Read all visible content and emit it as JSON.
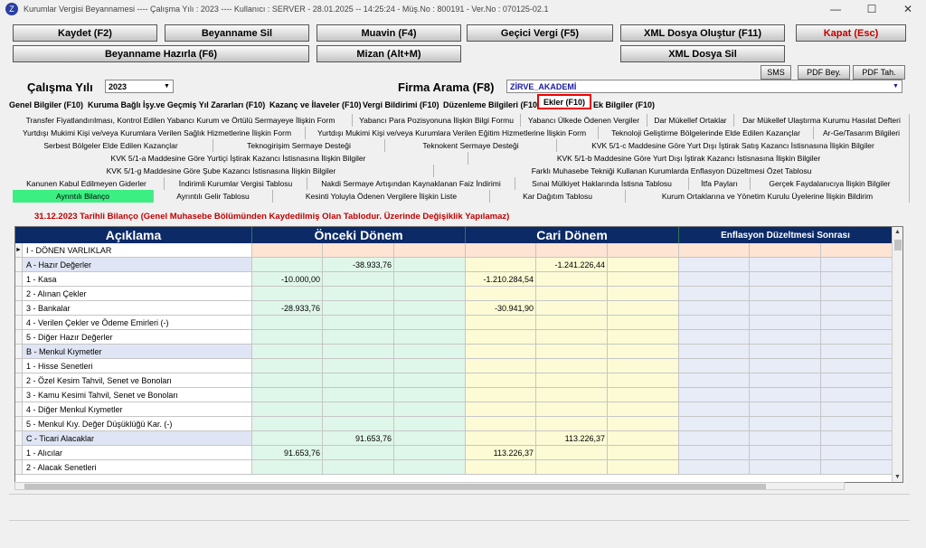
{
  "window": {
    "title": "Kurumlar Vergisi Beyannamesi  ----  Çalışma Yılı : 2023  ----  Kullanıcı : SERVER - 28.01.2025  --  14:25:24  -  Müş.No : 800191  - Ver.No : 070125-02.1",
    "minimize": "—",
    "maximize": "☐",
    "close": "✕"
  },
  "toolbar": {
    "save": "Kaydet (F2)",
    "delete_return": "Beyanname Sil",
    "muavin": "Muavin (F4)",
    "temp_tax": "Geçici Vergi (F5)",
    "xml_create": "XML Dosya Oluştur (F11)",
    "close": "Kapat (Esc)",
    "prepare_return": "Beyanname Hazırla (F6)",
    "mizan": "Mizan (Alt+M)",
    "xml_delete": "XML Dosya Sil",
    "sms": "SMS",
    "pdf_bey": "PDF Bey.",
    "pdf_tah": "PDF Tah."
  },
  "filters": {
    "year_label": "Çalışma Yılı",
    "year_value": "2023",
    "firm_label": "Firma Arama (F8)",
    "firm_value": "ZİRVE_AKADEMİ",
    "dropdown_arrow": "▼"
  },
  "main_tabs": [
    "Genel Bilgiler (F10)",
    "Kuruma Bağlı İşy.ve Geçmiş Yıl Zararları (F10)",
    "Kazanç ve İlaveler (F10)",
    "Vergi Bildirimi (F10)",
    "Düzenleme Bilgileri (F10)",
    "Ekler (F10)",
    "Ek Bilgiler (F10)"
  ],
  "annex_tabs": [
    "Transfer Fiyatlandırılması, Kontrol Edilen Yabancı Kurum ve Örtülü Sermayeye İlişkin Form",
    "Yabancı Para Pozisyonuna İlişkin Bilgi Formu",
    "Yabancı Ülkede Ödenen Vergiler",
    "Dar Mükellef Ortaklar",
    "Dar Mükellef Ulaştırma Kurumu Hasılat Defteri",
    "Yurtdışı Mukimi Kişi ve/veya Kurumlara Verilen Sağlık Hizmetlerine İlişkin Form",
    "Yurtdışı Mukimi Kişi ve/veya Kurumlara Verilen Eğitim Hizmetlerine İlişkin Form",
    "Teknoloji Geliştirme Bölgelerinde Elde Edilen Kazançlar",
    "Ar-Ge/Tasarım Bilgileri",
    "Serbest Bölgeler Elde Edilen Kazançlar",
    "Teknogirişim Sermaye Desteği",
    "Teknokent Sermaye Desteği",
    "KVK 5/1-c Maddesine Göre Yurt Dışı İştirak Satış Kazancı İstisnasına İlişkin Bilgiler",
    "KVK 5/1-a Maddesine Göre Yurtiçi İştirak Kazancı İstisnasına İlişkin Bilgiler",
    "KVK 5/1-b Maddesine Göre Yurt Dışı İştirak Kazancı İstisnasına İlişkin Bilgiler",
    "KVK 5/1-g Maddesine Göre Şube Kazancı İstisnasına İlişkin Bilgiler",
    "Farklı Muhasebe Tekniği Kullanan Kurumlarda Enflasyon Düzeltmesi Özet Tablosu",
    "Kanunen Kabul Edilmeyen Giderler",
    "İndirimli Kurumlar Vergisi Tablosu",
    "Nakdi Sermaye Artışından Kaynaklanan Faiz İndirimi",
    "Sınai Mülkiyet Haklarında İstisna Tablosu",
    "İtfa Payları",
    "Gerçek Faydalanıcıya İlişkin Bilgiler",
    "Ayrıntılı Bilanço",
    "Ayrıntılı Gelir Tablosu",
    "Kesinti Yoluyla Ödenen Vergilere İlişkin Liste",
    "Kar Dağıtım Tablosu",
    "Kurum Ortaklarına ve Yönetim Kurulu Üyelerine İlişkin Bildirim"
  ],
  "balance": {
    "title": "31.12.2023 Tarihli Bilanço (Genel Muhasebe Bölümünden Kaydedilmiş Olan Tablodur. Üzerinde Değişiklik Yapılamaz)",
    "columns": [
      "Açıklama",
      "Önceki Dönem",
      "Cari Dönem",
      "Enflasyon Düzeltmesi Sonrası"
    ],
    "rows": [
      {
        "label": "I - DÖNEN VARLIKLAR",
        "p1": "",
        "p2": "",
        "c1": "",
        "c2": ""
      },
      {
        "label": "A - Hazır Değerler",
        "p1": "",
        "p2": "-38.933,76",
        "c1": "",
        "c2": "-1.241.226,44"
      },
      {
        "label": "1 - Kasa",
        "p1": "-10.000,00",
        "p2": "",
        "c1": "-1.210.284,54",
        "c2": ""
      },
      {
        "label": "2 - Alınan Çekler",
        "p1": "",
        "p2": "",
        "c1": "",
        "c2": ""
      },
      {
        "label": "3 - Bankalar",
        "p1": "-28.933,76",
        "p2": "",
        "c1": "-30.941,90",
        "c2": ""
      },
      {
        "label": "4 - Verilen Çekler ve Ödeme Emirleri (-)",
        "p1": "",
        "p2": "",
        "c1": "",
        "c2": ""
      },
      {
        "label": "5 - Diğer Hazır Değerler",
        "p1": "",
        "p2": "",
        "c1": "",
        "c2": ""
      },
      {
        "label": "B - Menkul Kıymetler",
        "p1": "",
        "p2": "",
        "c1": "",
        "c2": ""
      },
      {
        "label": "1 - Hisse Senetleri",
        "p1": "",
        "p2": "",
        "c1": "",
        "c2": ""
      },
      {
        "label": "2 - Özel Kesim Tahvil, Senet ve Bonoları",
        "p1": "",
        "p2": "",
        "c1": "",
        "c2": ""
      },
      {
        "label": "3 - Kamu Kesimi Tahvil, Senet ve Bonoları",
        "p1": "",
        "p2": "",
        "c1": "",
        "c2": ""
      },
      {
        "label": "4 - Diğer Menkul Kıymetler",
        "p1": "",
        "p2": "",
        "c1": "",
        "c2": ""
      },
      {
        "label": "5 - Menkul Kıy. Değer Düşüklüğü Kar. (-)",
        "p1": "",
        "p2": "",
        "c1": "",
        "c2": ""
      },
      {
        "label": "C - Ticari Alacaklar",
        "p1": "",
        "p2": "91.653,76",
        "c1": "",
        "c2": "113.226,37"
      },
      {
        "label": "1 - Alıcılar",
        "p1": "91.653,76",
        "p2": "",
        "c1": "113.226,37",
        "c2": ""
      },
      {
        "label": "2 - Alacak Senetleri",
        "p1": "",
        "p2": "",
        "c1": "",
        "c2": ""
      }
    ]
  },
  "colors": {
    "header_bg": "#0b2a66",
    "prev_period": "#dff7ea",
    "cur_period": "#fcfbd5",
    "infl": "#e7ecf7",
    "row_blue": "#dfe5f4",
    "top_row": "#fde4d3",
    "selected_tab": "#3bef82",
    "active_border": "#e00000"
  }
}
